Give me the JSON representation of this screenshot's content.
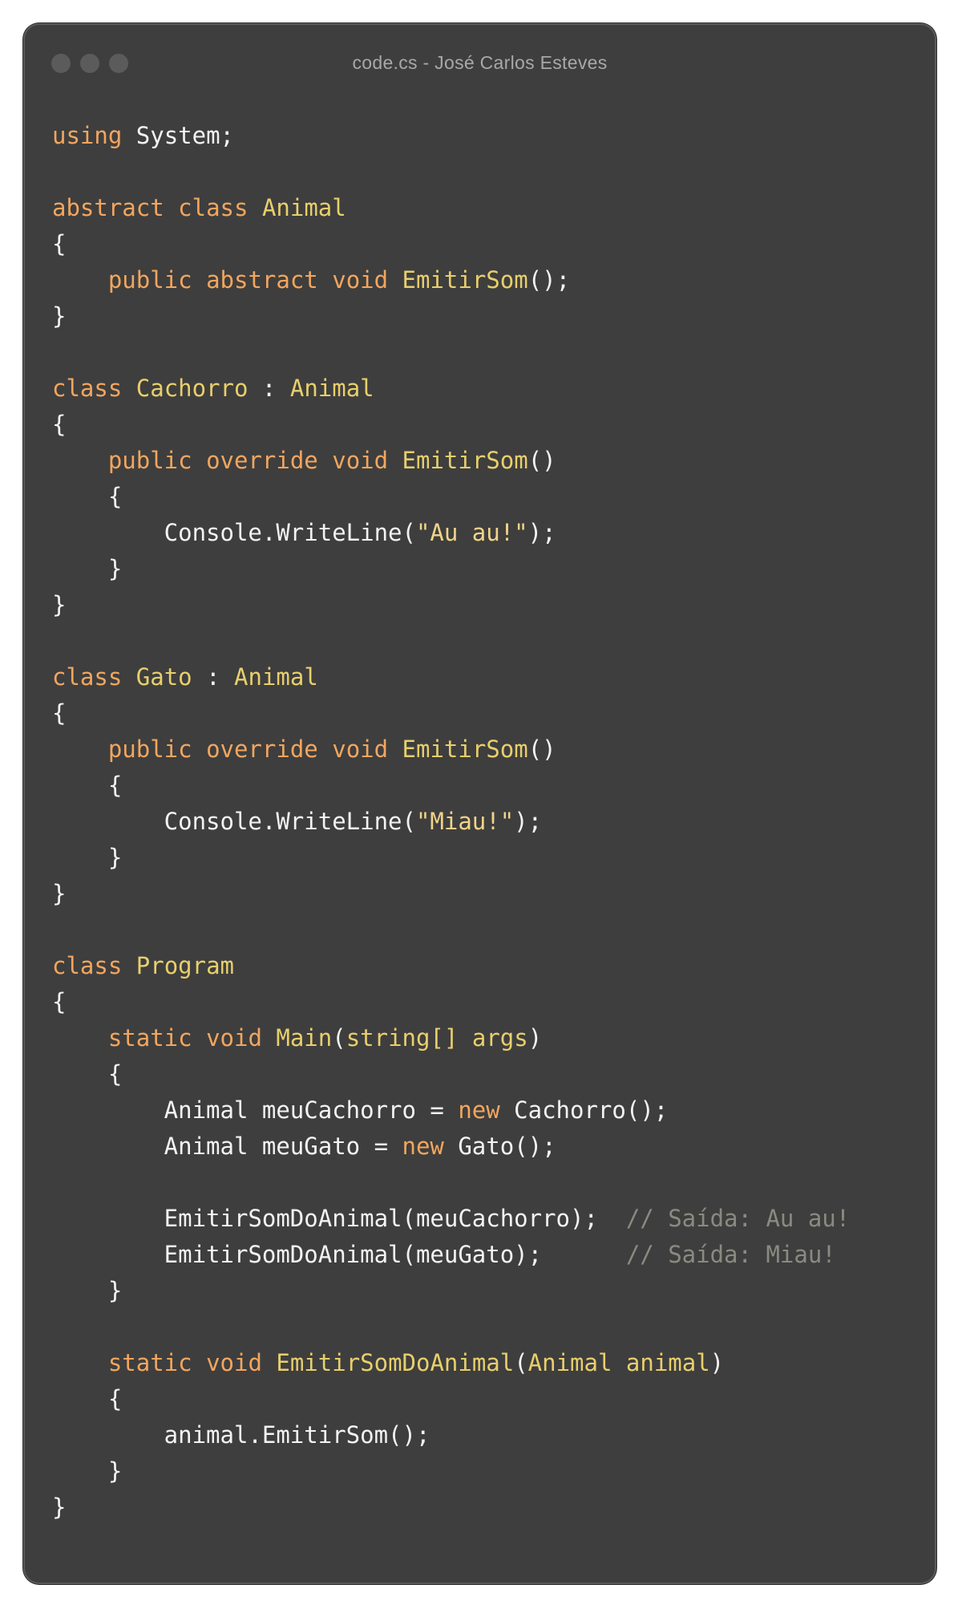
{
  "window": {
    "title": "code.cs - José Carlos Esteves",
    "buttons": [
      "close",
      "minimize",
      "maximize"
    ]
  },
  "code": {
    "lines": [
      [
        {
          "t": "using",
          "c": "kw"
        },
        {
          "t": " System;",
          "c": "tx"
        }
      ],
      [],
      [
        {
          "t": "abstract",
          "c": "kw"
        },
        {
          "t": " ",
          "c": "tx"
        },
        {
          "t": "class",
          "c": "kw"
        },
        {
          "t": " ",
          "c": "tx"
        },
        {
          "t": "Animal",
          "c": "ty"
        }
      ],
      [
        {
          "t": "{",
          "c": "tx"
        }
      ],
      [
        {
          "t": "    ",
          "c": "tx"
        },
        {
          "t": "public",
          "c": "kw"
        },
        {
          "t": " ",
          "c": "tx"
        },
        {
          "t": "abstract",
          "c": "kw"
        },
        {
          "t": " ",
          "c": "tx"
        },
        {
          "t": "void",
          "c": "kw"
        },
        {
          "t": " ",
          "c": "tx"
        },
        {
          "t": "EmitirSom",
          "c": "ty"
        },
        {
          "t": "();",
          "c": "tx"
        }
      ],
      [
        {
          "t": "}",
          "c": "tx"
        }
      ],
      [],
      [
        {
          "t": "class",
          "c": "kw"
        },
        {
          "t": " ",
          "c": "tx"
        },
        {
          "t": "Cachorro",
          "c": "ty"
        },
        {
          "t": " : ",
          "c": "tx"
        },
        {
          "t": "Animal",
          "c": "ty"
        }
      ],
      [
        {
          "t": "{",
          "c": "tx"
        }
      ],
      [
        {
          "t": "    ",
          "c": "tx"
        },
        {
          "t": "public",
          "c": "kw"
        },
        {
          "t": " ",
          "c": "tx"
        },
        {
          "t": "override",
          "c": "kw"
        },
        {
          "t": " ",
          "c": "tx"
        },
        {
          "t": "void",
          "c": "kw"
        },
        {
          "t": " ",
          "c": "tx"
        },
        {
          "t": "EmitirSom",
          "c": "ty"
        },
        {
          "t": "()",
          "c": "tx"
        }
      ],
      [
        {
          "t": "    {",
          "c": "tx"
        }
      ],
      [
        {
          "t": "        Console.WriteLine(",
          "c": "tx"
        },
        {
          "t": "\"Au au!\"",
          "c": "st"
        },
        {
          "t": ");",
          "c": "tx"
        }
      ],
      [
        {
          "t": "    }",
          "c": "tx"
        }
      ],
      [
        {
          "t": "}",
          "c": "tx"
        }
      ],
      [],
      [
        {
          "t": "class",
          "c": "kw"
        },
        {
          "t": " ",
          "c": "tx"
        },
        {
          "t": "Gato",
          "c": "ty"
        },
        {
          "t": " : ",
          "c": "tx"
        },
        {
          "t": "Animal",
          "c": "ty"
        }
      ],
      [
        {
          "t": "{",
          "c": "tx"
        }
      ],
      [
        {
          "t": "    ",
          "c": "tx"
        },
        {
          "t": "public",
          "c": "kw"
        },
        {
          "t": " ",
          "c": "tx"
        },
        {
          "t": "override",
          "c": "kw"
        },
        {
          "t": " ",
          "c": "tx"
        },
        {
          "t": "void",
          "c": "kw"
        },
        {
          "t": " ",
          "c": "tx"
        },
        {
          "t": "EmitirSom",
          "c": "ty"
        },
        {
          "t": "()",
          "c": "tx"
        }
      ],
      [
        {
          "t": "    {",
          "c": "tx"
        }
      ],
      [
        {
          "t": "        Console.WriteLine(",
          "c": "tx"
        },
        {
          "t": "\"Miau!\"",
          "c": "st"
        },
        {
          "t": ");",
          "c": "tx"
        }
      ],
      [
        {
          "t": "    }",
          "c": "tx"
        }
      ],
      [
        {
          "t": "}",
          "c": "tx"
        }
      ],
      [],
      [
        {
          "t": "class",
          "c": "kw"
        },
        {
          "t": " ",
          "c": "tx"
        },
        {
          "t": "Program",
          "c": "ty"
        }
      ],
      [
        {
          "t": "{",
          "c": "tx"
        }
      ],
      [
        {
          "t": "    ",
          "c": "tx"
        },
        {
          "t": "static",
          "c": "kw"
        },
        {
          "t": " ",
          "c": "tx"
        },
        {
          "t": "void",
          "c": "kw"
        },
        {
          "t": " ",
          "c": "tx"
        },
        {
          "t": "Main",
          "c": "ty"
        },
        {
          "t": "(",
          "c": "tx"
        },
        {
          "t": "string[]",
          "c": "ty"
        },
        {
          "t": " ",
          "c": "tx"
        },
        {
          "t": "args",
          "c": "ty"
        },
        {
          "t": ")",
          "c": "tx"
        }
      ],
      [
        {
          "t": "    {",
          "c": "tx"
        }
      ],
      [
        {
          "t": "        Animal meuCachorro = ",
          "c": "tx"
        },
        {
          "t": "new",
          "c": "kw"
        },
        {
          "t": " Cachorro();",
          "c": "tx"
        }
      ],
      [
        {
          "t": "        Animal meuGato = ",
          "c": "tx"
        },
        {
          "t": "new",
          "c": "kw"
        },
        {
          "t": " Gato();",
          "c": "tx"
        }
      ],
      [],
      [
        {
          "t": "        EmitirSomDoAnimal(meuCachorro);  ",
          "c": "tx"
        },
        {
          "t": "// Saída: Au au!",
          "c": "cm"
        }
      ],
      [
        {
          "t": "        EmitirSomDoAnimal(meuGato);      ",
          "c": "tx"
        },
        {
          "t": "// Saída: Miau!",
          "c": "cm"
        }
      ],
      [
        {
          "t": "    }",
          "c": "tx"
        }
      ],
      [],
      [
        {
          "t": "    ",
          "c": "tx"
        },
        {
          "t": "static",
          "c": "kw"
        },
        {
          "t": " ",
          "c": "tx"
        },
        {
          "t": "void",
          "c": "kw"
        },
        {
          "t": " ",
          "c": "tx"
        },
        {
          "t": "EmitirSomDoAnimal",
          "c": "ty"
        },
        {
          "t": "(",
          "c": "tx"
        },
        {
          "t": "Animal",
          "c": "ty"
        },
        {
          "t": " ",
          "c": "tx"
        },
        {
          "t": "animal",
          "c": "ty"
        },
        {
          "t": ")",
          "c": "tx"
        }
      ],
      [
        {
          "t": "    {",
          "c": "tx"
        }
      ],
      [
        {
          "t": "        animal.EmitirSom();",
          "c": "tx"
        }
      ],
      [
        {
          "t": "    }",
          "c": "tx"
        }
      ],
      [
        {
          "t": "}",
          "c": "tx"
        }
      ]
    ]
  },
  "colors": {
    "background": "#3e3e3e",
    "keyword": "#f2a65f",
    "type": "#e8cf6c",
    "string": "#f1d38a",
    "comment": "#8a8a82",
    "text": "#f3f3f3"
  }
}
